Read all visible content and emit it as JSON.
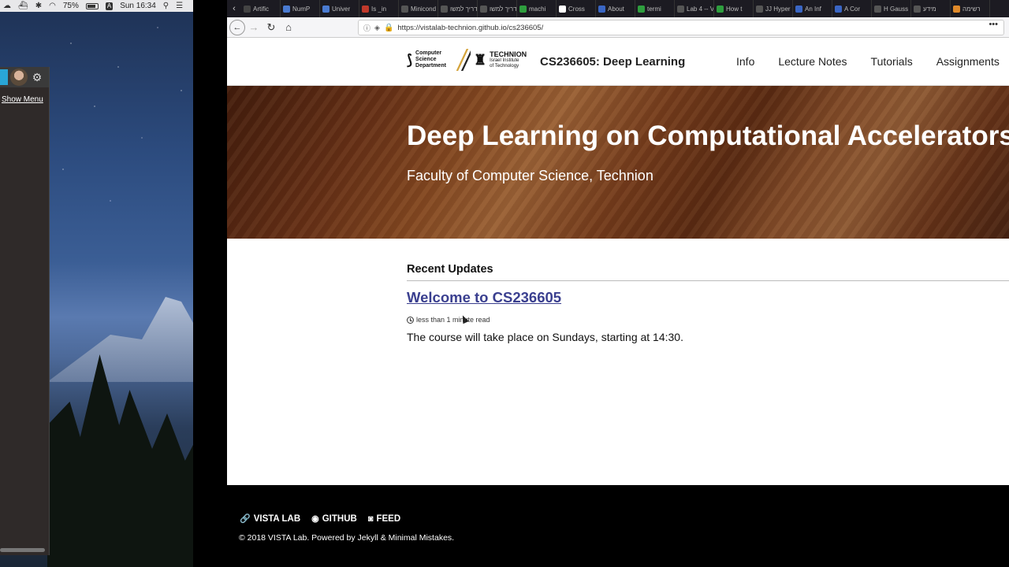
{
  "menubar": {
    "battery": "75%",
    "clock": "Sun 16:34",
    "input_source": "A"
  },
  "side_panel": {
    "show_menu": "Show Menu"
  },
  "tabs": [
    {
      "label": "Artific",
      "color": "#444"
    },
    {
      "label": "NumP",
      "color": "#4a7bd1"
    },
    {
      "label": "Univer",
      "color": "#4a7bd1"
    },
    {
      "label": "Is _in",
      "color": "#c0392b"
    },
    {
      "label": "Minicond",
      "color": "#555"
    },
    {
      "label": "מדריך למשו",
      "color": "#555"
    },
    {
      "label": "מדריך למשו",
      "color": "#555"
    },
    {
      "label": "machi",
      "color": "#2e9e3e"
    },
    {
      "label": "Cross",
      "color": "#fff"
    },
    {
      "label": "About",
      "color": "#3a66c4"
    },
    {
      "label": "termi",
      "color": "#2e9e3e"
    },
    {
      "label": "Lab 4 -- V",
      "color": "#555"
    },
    {
      "label": "How t",
      "color": "#2e9e3e"
    },
    {
      "label": "JJ Hyper",
      "color": "#555"
    },
    {
      "label": "An Inf",
      "color": "#3a66c4"
    },
    {
      "label": "A Cor",
      "color": "#3a66c4"
    },
    {
      "label": "H Gauss",
      "color": "#555"
    },
    {
      "label": "מידע",
      "color": "#555"
    },
    {
      "label": "רשימה",
      "color": "#e08a2a"
    }
  ],
  "address_bar": {
    "url": "https://vistalab-technion.github.io/cs236605/"
  },
  "header": {
    "logo_cs": "Computer Science Department",
    "logo_technion": "TECHNION",
    "logo_technion_sub": "Israel Institute of Technology",
    "site_title": "CS236605: Deep Learning",
    "nav": [
      "Info",
      "Lecture Notes",
      "Tutorials",
      "Assignments"
    ]
  },
  "hero": {
    "title": "Deep Learning on Computational Accelerators",
    "subtitle": "Faculty of Computer Science, Technion"
  },
  "main": {
    "section_title": "Recent Updates",
    "post_title": "Welcome to CS236605",
    "read_time": "less than 1 minute read",
    "excerpt": "The course will take place on Sundays, starting at 14:30."
  },
  "footer": {
    "links": [
      "VISTA LAB",
      "GITHUB",
      "FEED"
    ],
    "copyright": "© 2018 VISTA Lab. Powered by Jekyll & Minimal Mistakes."
  }
}
